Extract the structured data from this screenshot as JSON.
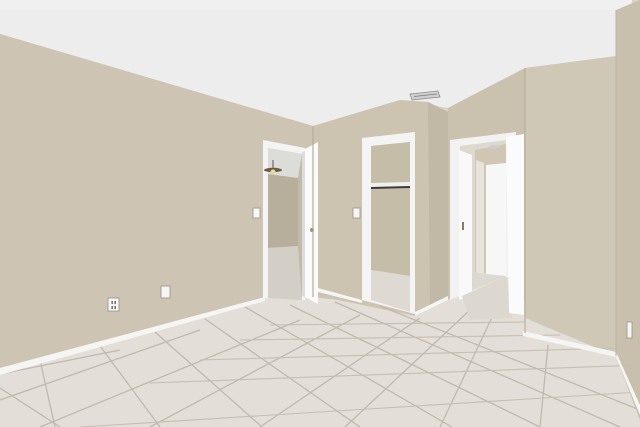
{
  "scene": {
    "subject": "empty-room-interior",
    "colors": {
      "wall": "#cfc6b5",
      "wall_shadow": "#b9b09e",
      "ceiling": "#eeeeee",
      "floor_tile": "#e2ddd6",
      "grout": "#bdb7ae",
      "baseboard": "#f4f4f2",
      "door": "#ffffff",
      "hallway": "#c9c0ae"
    },
    "icons": [
      "ceiling-vent-icon",
      "ceiling-fan-icon",
      "power-outlet-icon",
      "light-switch-icon",
      "closet-rod-icon",
      "door-hinge-icon"
    ]
  }
}
